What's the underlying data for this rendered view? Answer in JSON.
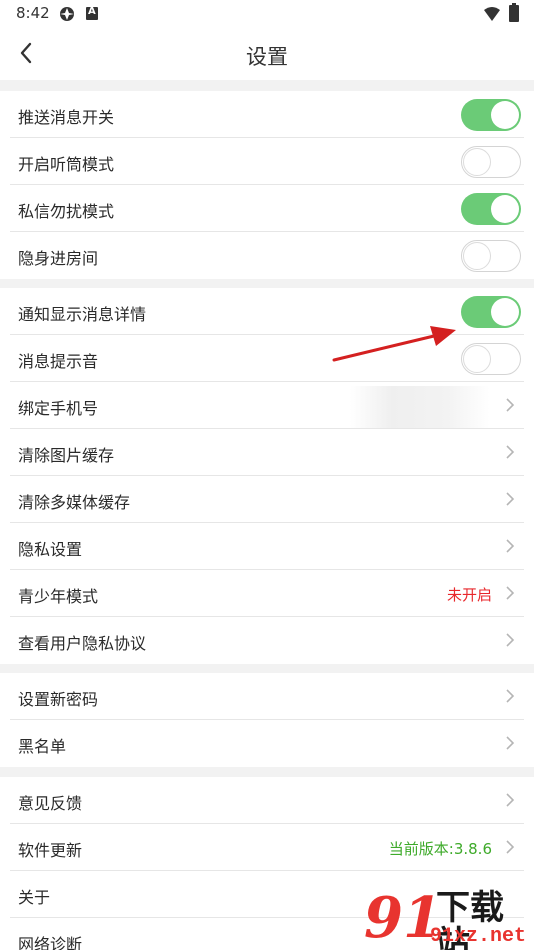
{
  "status_bar": {
    "time": "8:42"
  },
  "header": {
    "title": "设置"
  },
  "groups": [
    {
      "rows": [
        {
          "label": "推送消息开关",
          "toggle": "on"
        },
        {
          "label": "开启听筒模式",
          "toggle": "off"
        },
        {
          "label": "私信勿扰模式",
          "toggle": "on"
        },
        {
          "label": "隐身进房间",
          "toggle": "off"
        }
      ]
    },
    {
      "rows": [
        {
          "label": "通知显示消息详情",
          "toggle": "on"
        },
        {
          "label": "消息提示音",
          "toggle": "off"
        },
        {
          "label": "绑定手机号"
        },
        {
          "label": "清除图片缓存"
        },
        {
          "label": "清除多媒体缓存"
        },
        {
          "label": "隐私设置"
        },
        {
          "label": "青少年模式",
          "value": "未开启"
        },
        {
          "label": "查看用户隐私协议"
        }
      ]
    },
    {
      "rows": [
        {
          "label": "设置新密码"
        },
        {
          "label": "黑名单"
        }
      ]
    },
    {
      "rows": [
        {
          "label": "意见反馈"
        },
        {
          "label": "软件更新",
          "value": "当前版本:3.8.6"
        },
        {
          "label": "关于"
        },
        {
          "label": "网络诊断"
        }
      ]
    }
  ],
  "watermark": {
    "logo_number": "91",
    "title": "下载站",
    "url": "91xz.net"
  },
  "colors": {
    "toggle_on": "#6bcb77",
    "value_red": "#e8272b",
    "value_green": "#3eaa2a",
    "annotation_arrow": "#d42020"
  }
}
